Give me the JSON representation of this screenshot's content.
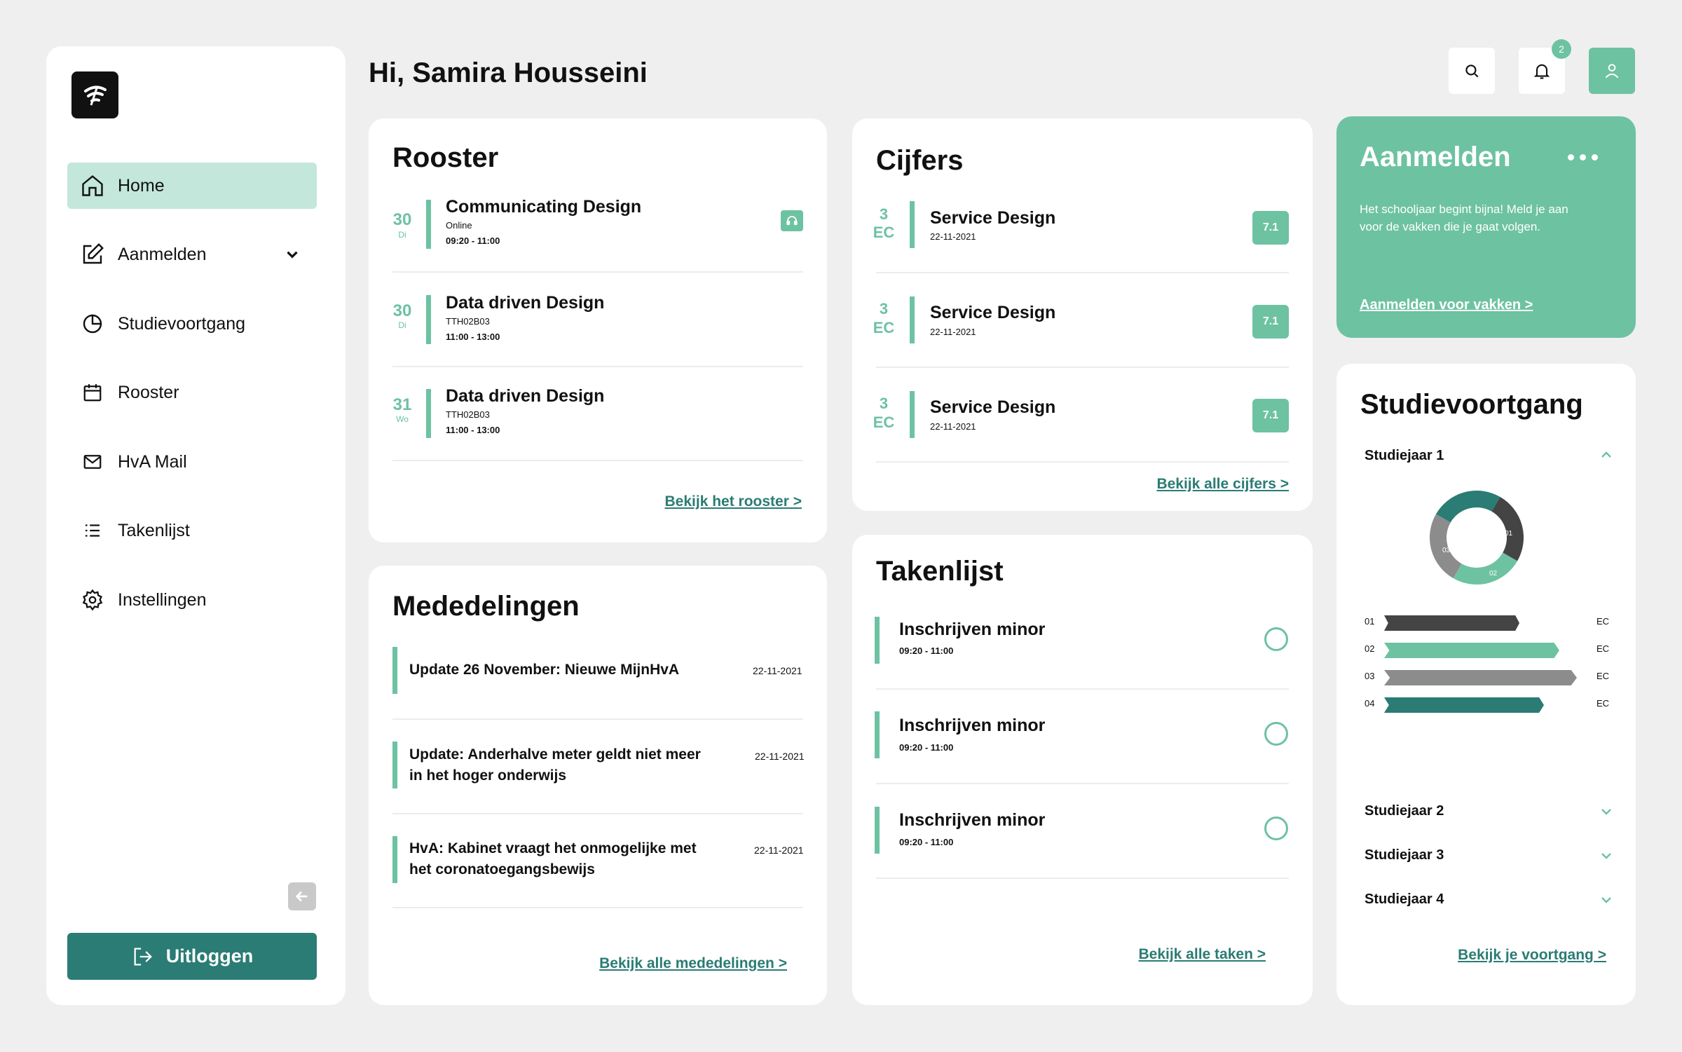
{
  "sidebar": {
    "items": [
      {
        "label": "Home",
        "icon": "home-icon"
      },
      {
        "label": "Aanmelden",
        "icon": "edit-icon"
      },
      {
        "label": "Studievoortgang",
        "icon": "pie-chart-icon"
      },
      {
        "label": "Rooster",
        "icon": "calendar-icon"
      },
      {
        "label": "HvA Mail",
        "icon": "mail-icon"
      },
      {
        "label": "Takenlijst",
        "icon": "list-icon"
      },
      {
        "label": "Instellingen",
        "icon": "gear-icon"
      }
    ],
    "logout_label": "Uitloggen"
  },
  "header": {
    "greeting": "Hi, Samira Housseini",
    "notification_count": "2"
  },
  "rooster": {
    "title": "Rooster",
    "events": [
      {
        "day": "30",
        "weekday": "Di",
        "title": "Communicating Design",
        "location": "Online",
        "time": "09:20 - 11:00"
      },
      {
        "day": "30",
        "weekday": "Di",
        "title": "Data driven Design",
        "location": "TTH02B03",
        "time": "11:00 - 13:00"
      },
      {
        "day": "31",
        "weekday": "Wo",
        "title": "Data driven Design",
        "location": "TTH02B03",
        "time": "11:00 - 13:00"
      }
    ],
    "link": "Bekijk het rooster >"
  },
  "cijfers": {
    "title": "Cijfers",
    "grades": [
      {
        "ec": "3",
        "ec_label": "EC",
        "course": "Service Design",
        "date": "22-11-2021",
        "grade": "7.1"
      },
      {
        "ec": "3",
        "ec_label": "EC",
        "course": "Service Design",
        "date": "22-11-2021",
        "grade": "7.1"
      },
      {
        "ec": "3",
        "ec_label": "EC",
        "course": "Service Design",
        "date": "22-11-2021",
        "grade": "7.1"
      }
    ],
    "link": "Bekijk alle cijfers >"
  },
  "aanmelden": {
    "title": "Aanmelden",
    "text": "Het schooljaar begint bijna! Meld je aan voor de vakken die je gaat volgen.",
    "link": "Aanmelden voor vakken >"
  },
  "mededelingen": {
    "title": "Mededelingen",
    "items": [
      {
        "title": "Update 26 November: Nieuwe MijnHvA",
        "date": "22-11-2021"
      },
      {
        "title": "Update: Anderhalve meter geldt niet meer in het hoger onderwijs",
        "date": "22-11-2021"
      },
      {
        "title": "HvA: Kabinet vraagt het onmogelijke met het coronatoegangsbewijs",
        "date": "22-11-2021"
      }
    ],
    "link": "Bekijk alle mededelingen >"
  },
  "takenlijst": {
    "title": "Takenlijst",
    "tasks": [
      {
        "title": "Inschrijven minor",
        "time": "09:20 - 11:00"
      },
      {
        "title": "Inschrijven minor",
        "time": "09:20 - 11:00"
      },
      {
        "title": "Inschrijven minor",
        "time": "09:20 - 11:00"
      }
    ],
    "link": "Bekijk alle taken >"
  },
  "studievoortgang": {
    "title": "Studievoortgang",
    "years": [
      "Studiejaar 1",
      "Studiejaar 2",
      "Studiejaar 3",
      "Studiejaar 4"
    ],
    "donut_labels": [
      "04",
      "01",
      "02",
      "03"
    ],
    "bars": [
      {
        "label": "01",
        "unit": "EC",
        "color": "#444444",
        "fill": 0.7
      },
      {
        "label": "02",
        "unit": "EC",
        "color": "#6dc2a2",
        "fill": 0.91
      },
      {
        "label": "03",
        "unit": "EC",
        "color": "#8c8c8c",
        "fill": 1.0
      },
      {
        "label": "04",
        "unit": "EC",
        "color": "#2a7c74",
        "fill": 0.83
      }
    ],
    "link": "Bekijk je voortgang >"
  },
  "colors": {
    "accent": "#6dc2a2",
    "dark_teal": "#2a7c74",
    "active_bg": "#c3e7da"
  }
}
